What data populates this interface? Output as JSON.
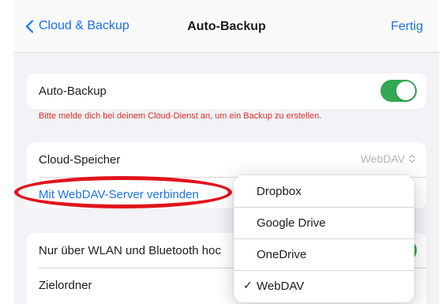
{
  "nav": {
    "back_label": "Cloud & Backup",
    "title": "Auto-Backup",
    "done_label": "Fertig"
  },
  "auto_backup": {
    "label": "Auto-Backup",
    "enabled": true,
    "hint": "Bitte melde dich bei deinem Cloud-Dienst an, um ein Backup zu erstellen."
  },
  "cloud": {
    "label": "Cloud-Speicher",
    "value": "WebDAV",
    "connect_link": "Mit WebDAV-Server verbinden"
  },
  "network": {
    "wifi_label": "Nur über WLAN und Bluetooth hoc",
    "folder_label": "Zielordner"
  },
  "menu": {
    "options": [
      "Dropbox",
      "Google Drive",
      "OneDrive",
      "WebDAV"
    ],
    "selected": "WebDAV"
  },
  "colors": {
    "accent": "#1a73e8",
    "toggle_on": "#34a853",
    "error": "#d93025",
    "annotation": "#e0141c"
  },
  "icons": {
    "back": "chevron-left-icon",
    "value": "chevron-up-down-icon",
    "selected": "checkmark-icon"
  }
}
